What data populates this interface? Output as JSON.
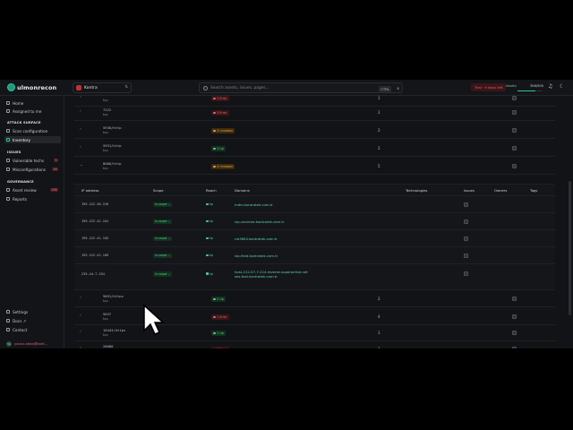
{
  "topbar": {
    "logo_text": "ulmonrecon",
    "project_name": "Kontra",
    "search_placeholder": "Search assets, issues, pages...",
    "shortcut": "CTRL",
    "shortcut_key": "K",
    "trial_label": "Trial · 9 days left",
    "usage_label": "Assets",
    "usage_value": "356/500",
    "usage_fraction": 0.71
  },
  "sidebar": {
    "items_top": [
      {
        "label": "Home",
        "icon": "home-icon"
      },
      {
        "label": "Assigned to me",
        "icon": "user-icon"
      }
    ],
    "section_attack": "ATTACK SURFACE",
    "items_attack": [
      {
        "label": "Scan configuration",
        "icon": "wrench-icon"
      },
      {
        "label": "Inventory",
        "icon": "inventory-icon",
        "active": true
      }
    ],
    "section_issues": "ISSUES",
    "items_issues": [
      {
        "label": "Vulnerable techs",
        "icon": "bug-icon",
        "count": "5"
      },
      {
        "label": "Misconfigurations",
        "icon": "alert-icon",
        "count": "16"
      }
    ],
    "section_gov": "GOVERNANCE",
    "items_gov": [
      {
        "label": "Asset review",
        "icon": "review-icon",
        "count": "108"
      },
      {
        "label": "Reports",
        "icon": "report-icon"
      }
    ],
    "items_bottom": [
      {
        "label": "Settings",
        "icon": "gear-icon"
      },
      {
        "label": "Docs ↗",
        "icon": "docs-icon"
      },
      {
        "label": "Contact",
        "icon": "mail-icon"
      }
    ],
    "user_initials": "YA",
    "user_name": "yavuz.altas@kont..."
  },
  "ports": [
    {
      "port": "",
      "proto": "tcp",
      "reach": "3 Error",
      "color": "red",
      "count": "1"
    },
    {
      "port": "7222",
      "proto": "tcp",
      "reach": "3 Error",
      "color": "red",
      "count": "2"
    },
    {
      "port": "5938/http",
      "proto": "tcp",
      "reach": "3 Unstable",
      "color": "orange",
      "count": "2"
    },
    {
      "port": "5931/http",
      "proto": "tcp",
      "reach": "3 Up",
      "color": "green",
      "count": "2"
    },
    {
      "port": "8080/http",
      "proto": "tcp",
      "reach": "4 Unstable",
      "color": "orange",
      "count": "5",
      "expanded": true
    }
  ],
  "subtable": {
    "headers": [
      "IP address",
      "Scope",
      "Reach",
      "Domains",
      "Technologies",
      "Issues",
      "Owners",
      "Tags"
    ],
    "rows": [
      {
        "ip": "195.222.36.226",
        "scope": "In-scope ⌄",
        "reach": "Up",
        "domains": [
          "mdm.kontratek.com.tr"
        ]
      },
      {
        "ip": "195.222.41.101",
        "scope": "In-scope ⌄",
        "reach": "Up",
        "domains": [
          "vip-canrene.kontratek.com.tr"
        ]
      },
      {
        "ip": "195.222.41.102",
        "scope": "In-scope ⌄",
        "reach": "Up",
        "domains": [
          "cw3604.kontratek.com.tr"
        ]
      },
      {
        "ip": "195.222.41.109",
        "scope": "In-scope ⌄",
        "reach": "Up",
        "domains": [
          "vip-field.kontratek.com.tr"
        ]
      },
      {
        "ip": "235.44.7.254",
        "scope": "In-scope ⌄",
        "reach": "Up",
        "domains": [
          "host-212-57-7-214.reverse.superonline.net",
          "ses-test.kontratek.com.tr"
        ]
      }
    ]
  },
  "ports_after": [
    {
      "port": "9091/https",
      "proto": "tcp",
      "reach": "2 Up",
      "color": "green",
      "count": "2"
    },
    {
      "port": "5037",
      "proto": "tcp",
      "reach": "1 Error",
      "color": "red",
      "count": "4"
    },
    {
      "port": "10443/https",
      "proto": "tcp",
      "reach": "1 Up",
      "color": "green",
      "count": "1"
    },
    {
      "port": "28080",
      "proto": "tcp",
      "reach": "1 Error",
      "color": "red",
      "count": "1"
    }
  ]
}
